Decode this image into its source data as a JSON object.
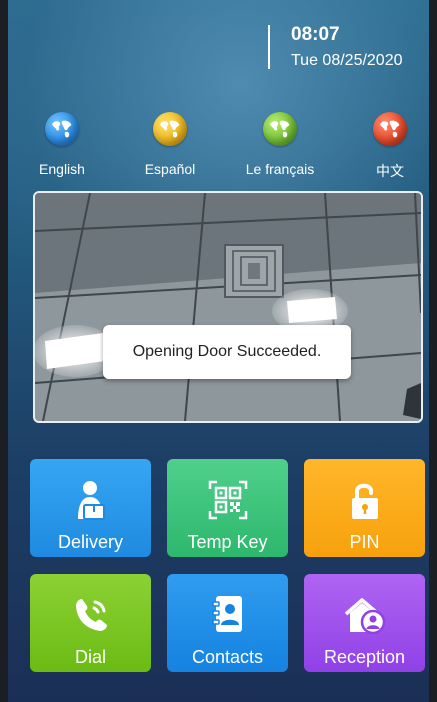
{
  "status": {
    "time": "08:07",
    "date": "Tue 08/25/2020"
  },
  "languages": [
    {
      "label": "English",
      "icon": "globe-icon",
      "color": "#2a8ee6"
    },
    {
      "label": "Español",
      "icon": "globe-icon",
      "color": "#f0b91c"
    },
    {
      "label": "Le français",
      "icon": "globe-icon",
      "color": "#74c236"
    },
    {
      "label": "中文",
      "icon": "globe-icon",
      "color": "#e94a2c"
    }
  ],
  "toast": {
    "message": "Opening Door Succeeded."
  },
  "tiles": [
    {
      "label": "Delivery",
      "icon": "delivery-person-icon"
    },
    {
      "label": "Temp Key",
      "icon": "qr-code-icon"
    },
    {
      "label": "PIN",
      "icon": "unlock-icon"
    },
    {
      "label": "Dial",
      "icon": "phone-icon"
    },
    {
      "label": "Contacts",
      "icon": "contacts-icon"
    },
    {
      "label": "Reception",
      "icon": "reception-icon"
    }
  ]
}
